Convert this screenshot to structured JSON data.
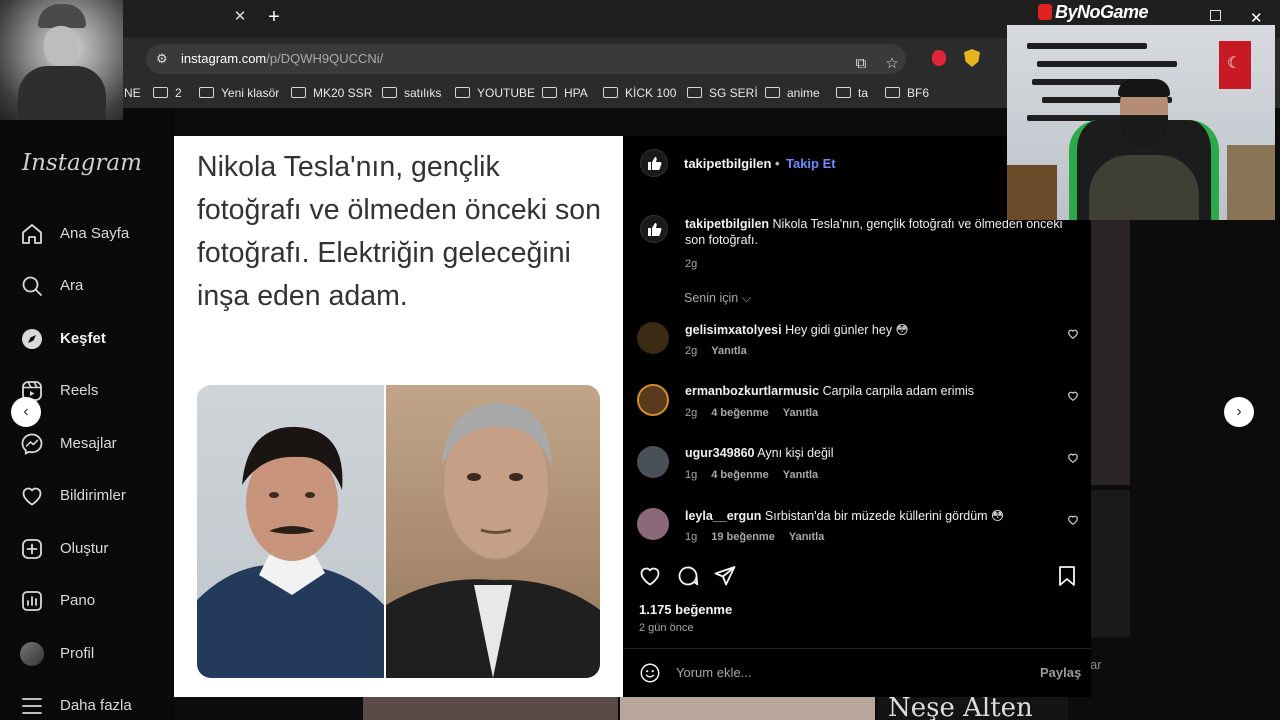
{
  "browser": {
    "tab_close": "✕",
    "new_tab": "+",
    "url_host": "instagram.com",
    "url_path": "/p/DQWH9QUCCNi/",
    "bookmarks": [
      "NE",
      "2",
      "Yeni klasör",
      "MK20 SSR",
      "satılıks",
      "YOUTUBE",
      "HPA",
      "KİCK 100",
      "SG SERİ",
      "anime",
      "ta",
      "BF6"
    ]
  },
  "sidebar": {
    "logo": "Instagram",
    "items": [
      {
        "label": "Ana Sayfa",
        "icon": "home-icon"
      },
      {
        "label": "Ara",
        "icon": "search-icon"
      },
      {
        "label": "Keşfet",
        "icon": "explore-icon",
        "active": true
      },
      {
        "label": "Reels",
        "icon": "reels-icon"
      },
      {
        "label": "Mesajlar",
        "icon": "messenger-icon"
      },
      {
        "label": "Bildirimler",
        "icon": "heart-icon"
      },
      {
        "label": "Oluştur",
        "icon": "create-icon"
      },
      {
        "label": "Pano",
        "icon": "dashboard-icon"
      },
      {
        "label": "Profil",
        "icon": "profile-avatar"
      },
      {
        "label": "Daha fazla",
        "icon": "menu-icon"
      }
    ]
  },
  "post": {
    "image_caption": "Nikola Tesla'nın, gençlik fotoğrafı ve ölmeden önceki son fotoğrafı. Elektriğin geleceğini inşa eden adam.",
    "author": "takipetbilgilen",
    "separator": "•",
    "follow_label": "Takip Et",
    "caption": "Nikola Tesla'nın, gençlik fotoğrafı ve ölmeden önceki son fotoğrafı.",
    "caption_time": "2g",
    "sort_label": "Senin için",
    "comments": [
      {
        "user": "gelisimxatolyesi",
        "text": "Hey gidi günler hey 😳",
        "time": "2g",
        "likes": "",
        "reply": "Yanıtla",
        "avatar_color": "#3b2a14"
      },
      {
        "user": "ermanbozkurtlarmusic",
        "text": "Carpila carpila adam erimis",
        "time": "2g",
        "likes": "4 beğenme",
        "reply": "Yanıtla",
        "avatar_color": "#5a3a1c"
      },
      {
        "user": "ugur349860",
        "text": "Aynı kişi değil",
        "time": "1g",
        "likes": "4 beğenme",
        "reply": "Yanıtla",
        "avatar_color": "#4a5058"
      },
      {
        "user": "leyla__ergun",
        "text": "Sırbistan'da bir müzede küllerini gördüm 😳",
        "time": "1g",
        "likes": "19 beğenme",
        "reply": "Yanıtla",
        "avatar_color": "#8a6a78"
      }
    ],
    "likes_count": "1.175 beğenme",
    "posted_ago": "2 gün önce",
    "comment_placeholder": "Yorum ekle...",
    "share_label": "Paylaş"
  },
  "overlay": {
    "brand": "ByNoGame",
    "window_close": "✕"
  },
  "background": {
    "partial_text": "Neşe Alten",
    "partial_label": "ar"
  },
  "colors": {
    "follow_link": "#6b8cff",
    "brand_red": "#dd2222"
  }
}
